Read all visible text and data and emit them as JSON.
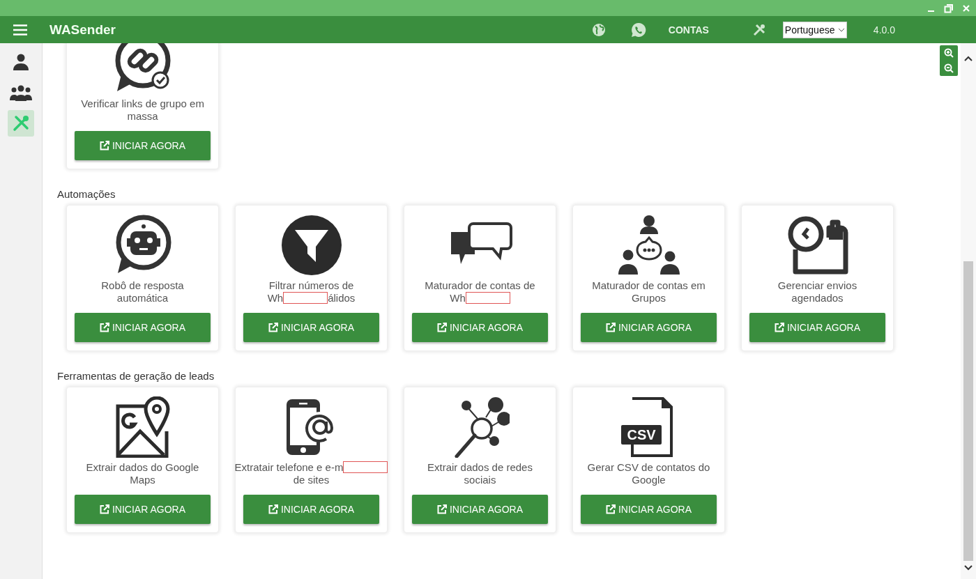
{
  "app": {
    "title": "WASender",
    "version": "4.0.0",
    "language": "Portuguese",
    "accounts_label": "CONTAS"
  },
  "sidebar": {
    "items": [
      {
        "kind": "contact",
        "selected": false
      },
      {
        "kind": "group",
        "selected": false
      },
      {
        "kind": "tools",
        "selected": true
      }
    ]
  },
  "sections": [
    {
      "cards": [
        {
          "kind": "link-chat",
          "title_lines": [
            [
              {
                "kind": "text",
                "text": "Verificar links de grupo em"
              }
            ],
            [
              {
                "kind": "text",
                "text": "massa"
              }
            ]
          ],
          "button": "INICIAR AGORA"
        }
      ]
    },
    {
      "heading": "Automações",
      "cards": [
        {
          "kind": "robot-chat",
          "title_lines": [
            [
              {
                "kind": "text",
                "text": "Robô de resposta"
              }
            ],
            [
              {
                "kind": "text",
                "text": "automática"
              }
            ]
          ],
          "button": "INICIAR AGORA"
        },
        {
          "kind": "filter",
          "title_lines": [
            [
              {
                "kind": "text",
                "text": "Filtrar números de"
              }
            ],
            [
              {
                "kind": "text",
                "text": "Wh"
              },
              {
                "kind": "redacted"
              },
              {
                "kind": "text",
                "text": "álidos"
              }
            ]
          ],
          "button": "INICIAR AGORA"
        },
        {
          "kind": "chat-bubbles",
          "title_lines": [
            [
              {
                "kind": "text",
                "text": "Maturador de contas de"
              }
            ],
            [
              {
                "kind": "text",
                "text": "Wh"
              },
              {
                "kind": "redacted"
              }
            ]
          ],
          "button": "INICIAR AGORA"
        },
        {
          "kind": "group-chat",
          "title_lines": [
            [
              {
                "kind": "text",
                "text": "Maturador de contas em"
              }
            ],
            [
              {
                "kind": "text",
                "text": "Grupos"
              }
            ]
          ],
          "button": "INICIAR AGORA"
        },
        {
          "kind": "clock-board",
          "title_lines": [
            [
              {
                "kind": "text",
                "text": "Gerenciar envios"
              }
            ],
            [
              {
                "kind": "text",
                "text": "agendados"
              }
            ]
          ],
          "button": "INICIAR AGORA"
        }
      ]
    },
    {
      "heading": "Ferramentas de geração de leads",
      "cards": [
        {
          "kind": "map-pin",
          "title_lines": [
            [
              {
                "kind": "text",
                "text": "Extrair dados do Google"
              }
            ],
            [
              {
                "kind": "text",
                "text": "Maps"
              }
            ]
          ],
          "button": "INICIAR AGORA"
        },
        {
          "kind": "phone-at",
          "title_lines": [
            [
              {
                "kind": "text",
                "text": "Extratair telefone e e-m"
              },
              {
                "kind": "redacted"
              }
            ],
            [
              {
                "kind": "text",
                "text": "de sites"
              }
            ]
          ],
          "button": "INICIAR AGORA"
        },
        {
          "kind": "social-search",
          "title_lines": [
            [
              {
                "kind": "text",
                "text": "Extrair dados de redes"
              }
            ],
            [
              {
                "kind": "text",
                "text": "sociais"
              }
            ]
          ],
          "button": "INICIAR AGORA"
        },
        {
          "kind": "csv-file",
          "icon_label": "CSV",
          "title_lines": [
            [
              {
                "kind": "text",
                "text": "Gerar CSV de contatos do"
              }
            ],
            [
              {
                "kind": "text",
                "text": "Google"
              }
            ]
          ],
          "button": "INICIAR AGORA"
        }
      ]
    }
  ]
}
